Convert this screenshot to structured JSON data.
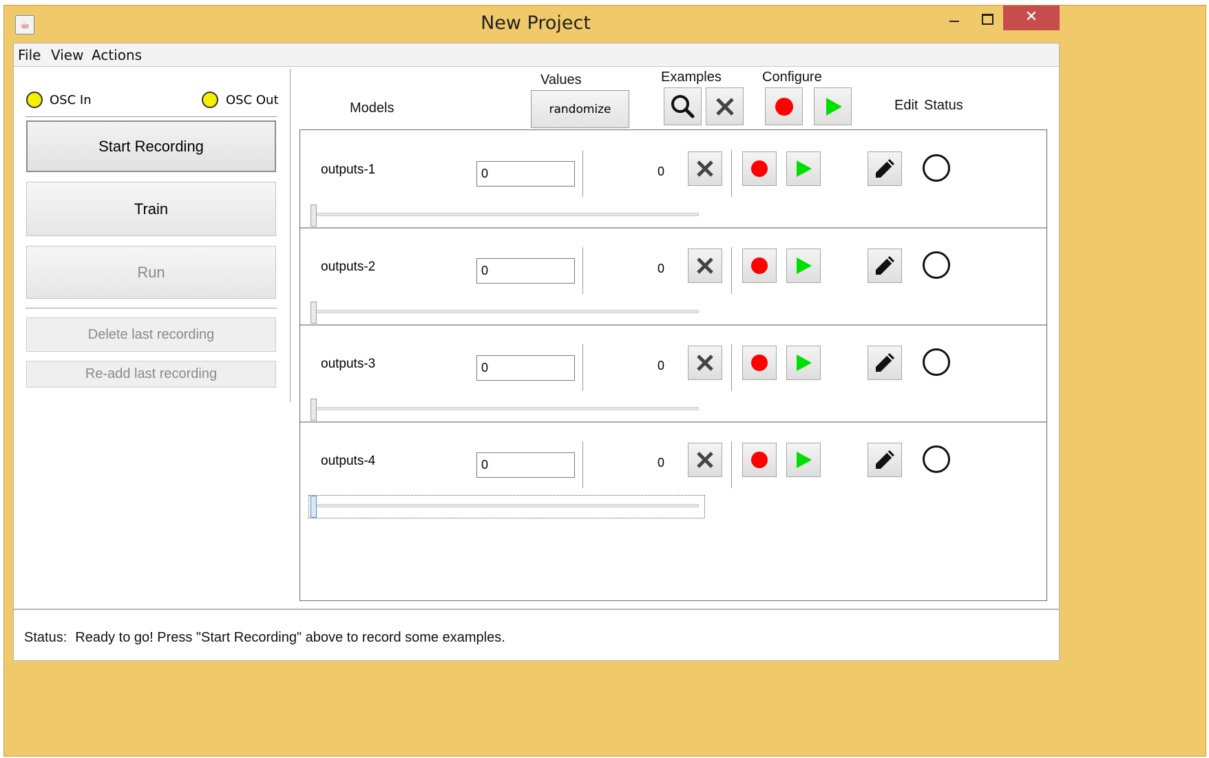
{
  "window": {
    "title": "New Project",
    "close_symbol": "✕"
  },
  "menu": [
    "File",
    "View",
    "Actions"
  ],
  "osc": {
    "in_label": "OSC In",
    "out_label": "OSC Out",
    "indicator_color": "#f5ef00"
  },
  "controls": {
    "start_recording": "Start Recording",
    "train": "Train",
    "run": "Run",
    "delete_last": "Delete last recording",
    "readd_last": "Re-add last recording"
  },
  "header": {
    "models": "Models",
    "values": "Values",
    "randomize": "randomize",
    "examples": "Examples",
    "configure": "Configure",
    "edit": "Edit",
    "status": "Status"
  },
  "models": [
    {
      "name": "outputs-1",
      "value": "0",
      "examples": "0",
      "slider": 0
    },
    {
      "name": "outputs-2",
      "value": "0",
      "examples": "0",
      "slider": 0
    },
    {
      "name": "outputs-3",
      "value": "0",
      "examples": "0",
      "slider": 0
    },
    {
      "name": "outputs-4",
      "value": "0",
      "examples": "0",
      "slider": 0
    }
  ],
  "statusbar": {
    "label": "Status:",
    "message": "Ready to go! Press \"Start Recording\" above to record some examples."
  },
  "colors": {
    "record": "#ff0000",
    "play": "#00e000",
    "window_frame": "#f0c96a",
    "close": "#c74d4d"
  }
}
